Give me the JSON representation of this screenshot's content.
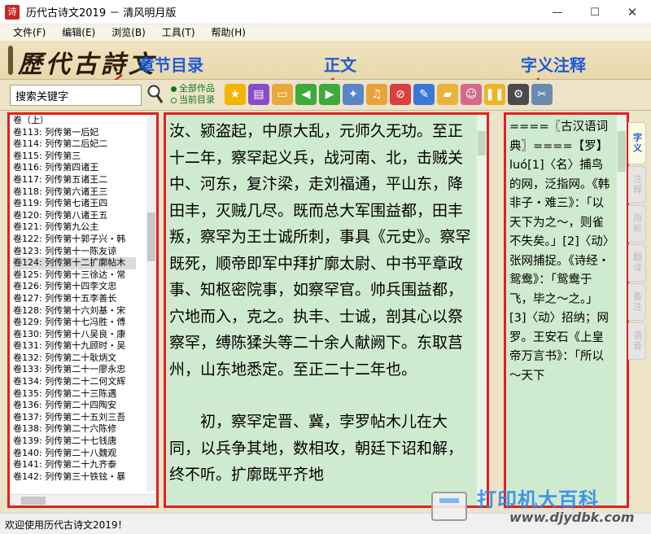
{
  "window": {
    "title": "历代古诗文2019 － 清风明月版",
    "app_icon": "诗",
    "minimize": "—",
    "maximize": "☐",
    "close": "✕"
  },
  "menu": [
    "文件(F)",
    "编辑(E)",
    "浏览(B)",
    "工具(T)",
    "帮助(H)"
  ],
  "banner": {
    "logo": "歷代古詩文",
    "annotations": {
      "toc": "章节目录",
      "body": "正文",
      "notes": "字义注释"
    }
  },
  "toolbar": {
    "search_value": "搜索关键字",
    "scope_all": "全部作品",
    "scope_current": "当前目录",
    "tool_icons": [
      "star-icon",
      "book-icon",
      "folder-open-icon",
      "back-arrow-icon",
      "forward-arrow-icon",
      "satellite-icon",
      "music-off-icon",
      "speaker-off-icon",
      "edit-icon",
      "folder-icon",
      "people-icon",
      "pause-icon",
      "settings-icon",
      "tools-icon"
    ]
  },
  "left_list": {
    "header": "卷（上）",
    "items": [
      "卷113: 列传第一后妃",
      "卷114: 列传第二后妃二",
      "卷115: 列传第三",
      "卷116: 列传第四诸王",
      "卷117: 列传第五诸王二",
      "卷118: 列传第六诸王三",
      "卷119: 列传第七诸王四",
      "卷120: 列传第八诸王五",
      "卷121: 列传第九公主",
      "卷122: 列传第十郭子兴・韩",
      "卷123: 列传第十一陈友谅",
      "卷124: 列传第十二扩廓帖木",
      "卷125: 列传第十三徐达・常",
      "卷126: 列传第十四李文忠",
      "卷127: 列传第十五李善长",
      "卷128: 列传第十六刘基・宋",
      "卷129: 列传第十七冯胜・傅",
      "卷130: 列传第十八吴良・康",
      "卷131: 列传第十九顾时・吴",
      "卷132: 列传第二十耿炳文",
      "卷133: 列传第二十一廖永忠",
      "卷134: 列传第二十二何文辉",
      "卷135: 列传第二十三陈遇",
      "卷136: 列传第二十四陶安",
      "卷137: 列传第二十五刘三吾",
      "卷138: 列传第二十六陈修",
      "卷139: 列传第二十七钱唐",
      "卷140: 列传第二十八魏观",
      "卷141: 列传第二十九齐泰",
      "卷142: 列传第三十铁铉・暴"
    ],
    "selected_index": 11
  },
  "body": {
    "paragraphs": [
      "汝、颍盗起，中原大乱，元师久无功。至正十二年，察罕起义兵，战河南、北，击贼关中、河东，复汴梁，走刘福通，平山东，降田丰，灭贼几尽。既而总大军围益都，田丰叛，察罕为王士诚所刺，事具《元史》。察罕既死，顺帝即军中拜扩廓太尉、中书平章政事、知枢密院事，如察罕官。帅兵围益都，穴地而入，克之。执丰、士诚，剖其心以祭察罕，缚陈猱头等二十余人献阙下。东取莒州，山东地悉定。至正二十二年也。",
      "　　初，察罕定晋、冀，孛罗帖木儿在大同，以兵争其地，数相攻，朝廷下诏和解，终不听。扩廓既平齐地"
    ]
  },
  "notes": {
    "text": "====〖古汉语词典〗====【罗】 luó[1]〈名〉捕鸟的网，泛指网。《韩非子・难三》：「以天下为之～，则雀不失矣。」[2]〈动〉张网捕捉。《诗经・鸳鸯》：「鸳鸯于飞，毕之～之。」[3]〈动〉招纳；网罗。王安石《上皇帝万言书》：「所以～天下"
  },
  "side_tabs": [
    "字义",
    "注释",
    "简析",
    "翻译",
    "备注",
    "语音"
  ],
  "status": {
    "text": "欢迎使用历代古诗文2019！"
  },
  "watermark": {
    "text": "打印机大百科",
    "url": "www.djydbk.com"
  }
}
